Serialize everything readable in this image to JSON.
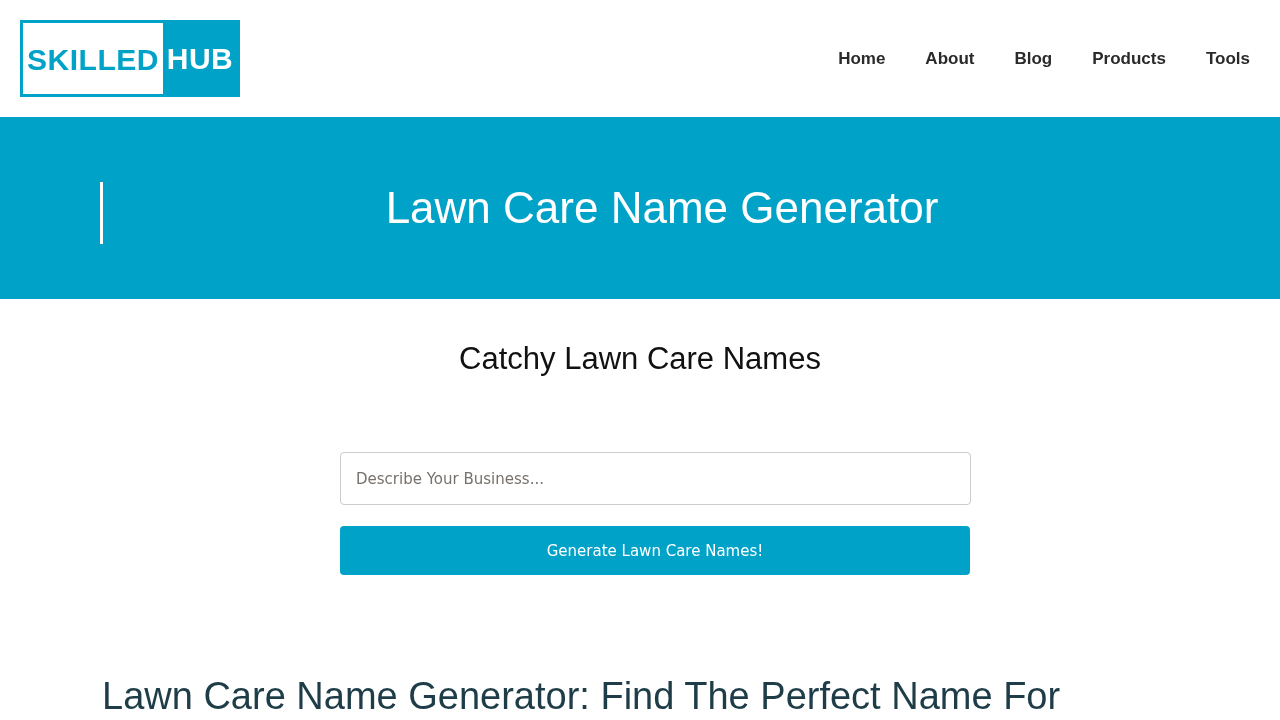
{
  "header": {
    "logo": {
      "primary": "SKILLED",
      "accent": "HUB"
    },
    "nav": [
      "Home",
      "About",
      "Blog",
      "Products",
      "Tools"
    ]
  },
  "hero": {
    "title": "Lawn Care Name Generator"
  },
  "generator": {
    "heading": "Catchy Lawn Care Names",
    "input": {
      "placeholder": "Describe Your Business..."
    },
    "button": "Generate Lawn Care Names!"
  },
  "article": {
    "heading": "Lawn Care Name Generator: Find The Perfect Name For"
  }
}
